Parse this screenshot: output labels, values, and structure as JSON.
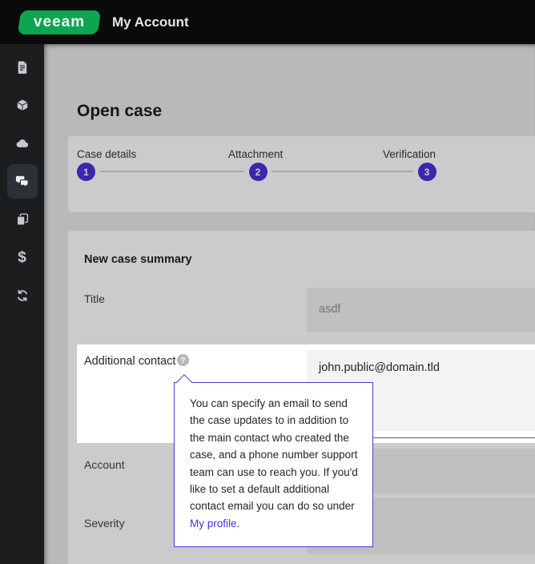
{
  "topbar": {
    "logo_text": "veeam",
    "app_title": "My Account"
  },
  "sidebar": {
    "active_index": 3,
    "items": [
      {
        "icon": "document-icon"
      },
      {
        "icon": "cube-icon"
      },
      {
        "icon": "cloud-icon"
      },
      {
        "icon": "chat-bubbles-icon"
      },
      {
        "icon": "copy-pages-icon"
      },
      {
        "icon": "dollar-icon",
        "glyph": "$"
      },
      {
        "icon": "sync-icon"
      }
    ]
  },
  "page": {
    "title": "Open case"
  },
  "stepper": {
    "steps": [
      {
        "number": "1",
        "label": "Case details"
      },
      {
        "number": "2",
        "label": "Attachment"
      },
      {
        "number": "3",
        "label": "Verification"
      }
    ]
  },
  "form": {
    "section_title": "New case summary",
    "fields": {
      "title": {
        "label": "Title",
        "value": "asdf"
      },
      "additional_contact": {
        "label": "Additional contact",
        "help_glyph": "?",
        "email_value": "john.public@domain.tld"
      },
      "account": {
        "label": "Account",
        "value": ""
      },
      "severity": {
        "label": "Severity",
        "value": ""
      }
    }
  },
  "tooltip": {
    "text_before": "You can specify an email to send the case updates to in addition to the main contact who created the case, and a phone number support team can use to reach you. If you'd like to set a default additional contact email you can do so under ",
    "link_label": "My profile",
    "text_after": "."
  },
  "colors": {
    "brand_green": "#0ea551",
    "accent_indigo": "#4631d8",
    "tooltip_border": "#5236d6",
    "link": "#4a2fe0",
    "topbar_bg": "#0a0a0a",
    "sidebar_bg": "#1b1d1f",
    "dim_scrim": "rgba(8,8,10,0.21)"
  }
}
